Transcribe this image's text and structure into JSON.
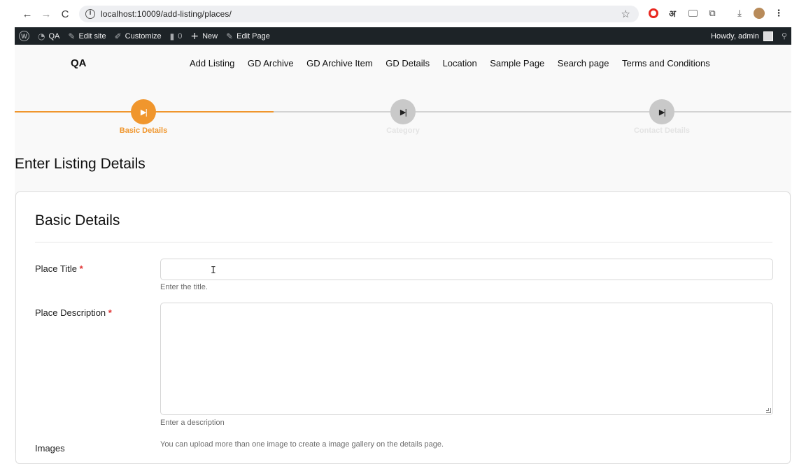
{
  "browser": {
    "back_icon": "←",
    "forward_icon": "→",
    "reload_icon": "C",
    "url": "localhost:10009/add-listing/places/",
    "star_icon": "☆",
    "hindi_ext": "अ",
    "puzzle_icon": "⧉",
    "download_icon": "⤓",
    "menu_icon": "⋮"
  },
  "adminbar": {
    "site_name": "QA",
    "edit_site": "Edit site",
    "customize": "Customize",
    "comments_count": "0",
    "new": "New",
    "edit_page": "Edit Page",
    "howdy": "Howdy, admin"
  },
  "site": {
    "title": "QA",
    "nav": [
      "Add Listing",
      "GD Archive",
      "GD Archive Item",
      "GD Details",
      "Location",
      "Sample Page",
      "Search page",
      "Terms and Conditions"
    ]
  },
  "stepper": {
    "steps": [
      {
        "label": "Basic Details",
        "state": "active"
      },
      {
        "label": "Category",
        "state": "inactive"
      },
      {
        "label": "Contact Details",
        "state": "inactive"
      }
    ],
    "accent_color": "#f0962d"
  },
  "page": {
    "heading": "Enter Listing Details"
  },
  "form": {
    "section_title": "Basic Details",
    "place_title_label": "Place Title",
    "place_title_value": "",
    "place_title_help": "Enter the title.",
    "place_description_label": "Place Description",
    "place_description_help": "Enter a description",
    "images_label": "Images",
    "images_help": "You can upload more than one image to create a image gallery on the details page.",
    "required_mark": "*"
  }
}
